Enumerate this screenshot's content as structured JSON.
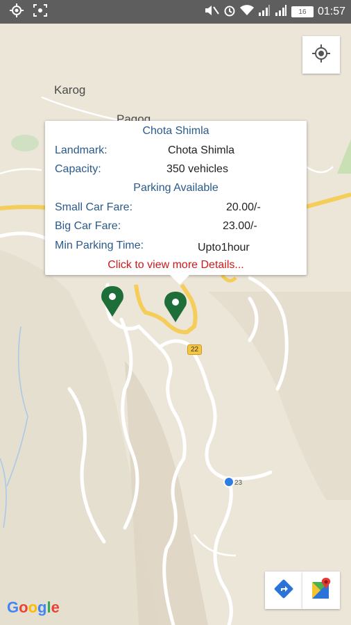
{
  "status_bar": {
    "time": "01:57",
    "battery": "16"
  },
  "map": {
    "places": [
      "Karog",
      "Pagog"
    ],
    "road_shield": "22",
    "road_tag": "23"
  },
  "info_window": {
    "title": "Chota Shimla",
    "landmark_label": "Landmark:",
    "landmark_value": "Chota Shimla",
    "capacity_label": "Capacity:",
    "capacity_value": "350 vehicles",
    "status": "Parking Available",
    "small_car_label": "Small Car Fare:",
    "small_car_value": "20.00/-",
    "big_car_label": "Big Car Fare:",
    "big_car_value": "23.00/-",
    "min_time_label": "Min Parking Time:",
    "min_time_value": "Upto1hour",
    "details_link": "Click to view more Details..."
  },
  "branding": {
    "google": "Google"
  },
  "colors": {
    "marker": "#1e6e3a",
    "link": "#cc1a1a",
    "label": "#2a5a8a",
    "user_dot": "#2f7de1"
  },
  "icons": [
    "location-icon",
    "screenshot-icon",
    "mute-icon",
    "alarm-icon",
    "wifi-icon",
    "signal-icon",
    "my-location-icon",
    "directions-icon",
    "google-maps-icon",
    "parking-marker-icon"
  ]
}
